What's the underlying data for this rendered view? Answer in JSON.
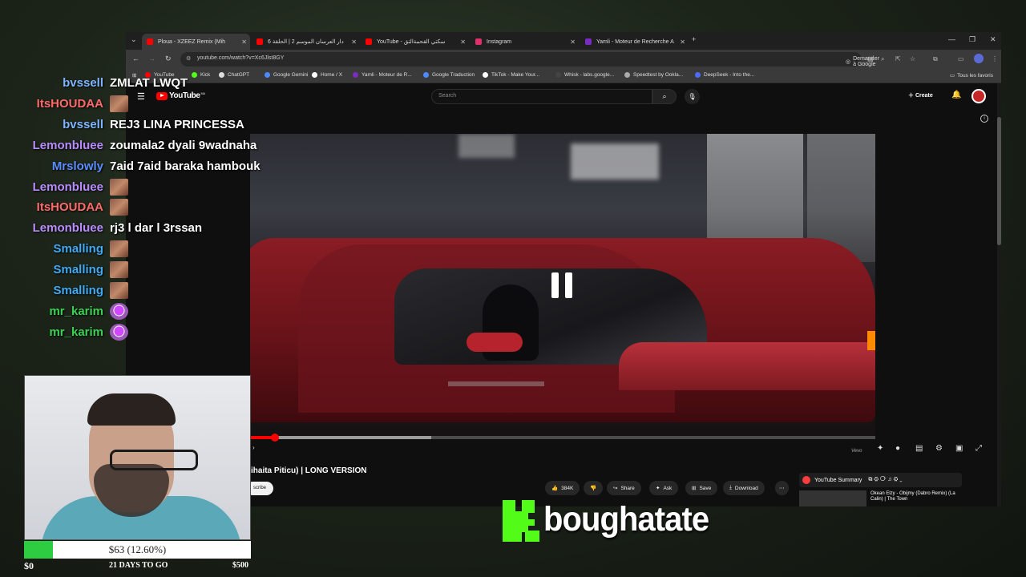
{
  "browser": {
    "tabs": [
      {
        "label": "Ploua - XZEEZ Remix (Mih",
        "favicon_color": "#ff0000",
        "active": true
      },
      {
        "label": "دار العرسان الموسم 2 | الحلقة 6",
        "favicon_color": "#ff0000",
        "active": false
      },
      {
        "label": "YouTube - سكتي القحمةالتق",
        "favicon_color": "#ff0000",
        "active": false
      },
      {
        "label": "Instagram",
        "favicon_color": "#e1306c",
        "active": false
      },
      {
        "label": "Yamli - Moteur de Recherche A",
        "favicon_color": "#7b2cbf",
        "active": false
      }
    ],
    "url": "youtube.com/watch?v=Xc6Jlst8GY",
    "google_pill": "Demander à Google",
    "bookmarks": [
      {
        "label": "YouTube",
        "color": "#ff0000"
      },
      {
        "label": "Kick",
        "color": "#53fc18"
      },
      {
        "label": "ChatGPT",
        "color": "#dddddd"
      },
      {
        "label": "Google Gemini",
        "color": "#4a8cff"
      },
      {
        "label": "Home / X",
        "color": "#ffffff"
      },
      {
        "label": "Yamli - Moteur de R...",
        "color": "#7b2cbf"
      },
      {
        "label": "Google Traduction",
        "color": "#4a8cff"
      },
      {
        "label": "TikTok - Make Your...",
        "color": "#ffffff"
      },
      {
        "label": "Whisk - labs.google...",
        "color": "#444444"
      },
      {
        "label": "Speedtest by Ookla...",
        "color": "#aaaaaa"
      },
      {
        "label": "DeepSeek - Into the...",
        "color": "#4d6bfe"
      }
    ],
    "bookmarks_folder": "Tous les favoris"
  },
  "youtube": {
    "logo": "YouTube",
    "logo_region": "MA",
    "search_placeholder": "Search",
    "create_label": "Create",
    "video_title": "ihaita Piticu) | LONG VERSION",
    "subscribe_label": "scribe",
    "actions": {
      "likes": "384K",
      "share": "Share",
      "ask": "Ask",
      "save": "Save",
      "download": "Download"
    },
    "progress": {
      "played": 0.04,
      "buffered": 0.29
    },
    "summary_label": "YouTube Summary",
    "next_video_title": "Okean Elzy - Obijmy (Dabro Remix) (La Calin) | The Town"
  },
  "chat": [
    {
      "user": "bvssell",
      "color": "#7fb4ff",
      "message": "ZMLAT LWQT"
    },
    {
      "user": "ItsHOUDAA",
      "color": "#ff6a6a",
      "emote": "face"
    },
    {
      "user": "bvssell",
      "color": "#7fb4ff",
      "message": "REJ3 LINA PRINCESSA"
    },
    {
      "user": "Lemonbluee",
      "color": "#b98cff",
      "message": "zoumala2 dyali 9wadnaha"
    },
    {
      "user": "Mrslowly",
      "color": "#5b8cff",
      "message": "7aid 7aid baraka hambouk"
    },
    {
      "user": "Lemonbluee",
      "color": "#b98cff",
      "emote": "face"
    },
    {
      "user": "ItsHOUDAA",
      "color": "#ff6a6a",
      "emote": "face"
    },
    {
      "user": "Lemonbluee",
      "color": "#b98cff",
      "message": "rj3 l dar l 3rssan"
    },
    {
      "user": "Smalling",
      "color": "#3fa9f5",
      "emote": "face"
    },
    {
      "user": "Smalling",
      "color": "#3fa9f5",
      "emote": "face"
    },
    {
      "user": "Smalling",
      "color": "#3fa9f5",
      "emote": "face"
    },
    {
      "user": "mr_karim",
      "color": "#39d353",
      "emote": "purple"
    },
    {
      "user": "mr_karim",
      "color": "#39d353",
      "emote": "purple"
    }
  ],
  "goal": {
    "label": "$63 (12.60%)",
    "fraction": 0.126,
    "fill_color": "#2ecc40",
    "min": "$0",
    "days": "21 DAYS TO GO",
    "max": "$500"
  },
  "brand": {
    "name": "boughatate",
    "logo_color": "#53fc18"
  }
}
